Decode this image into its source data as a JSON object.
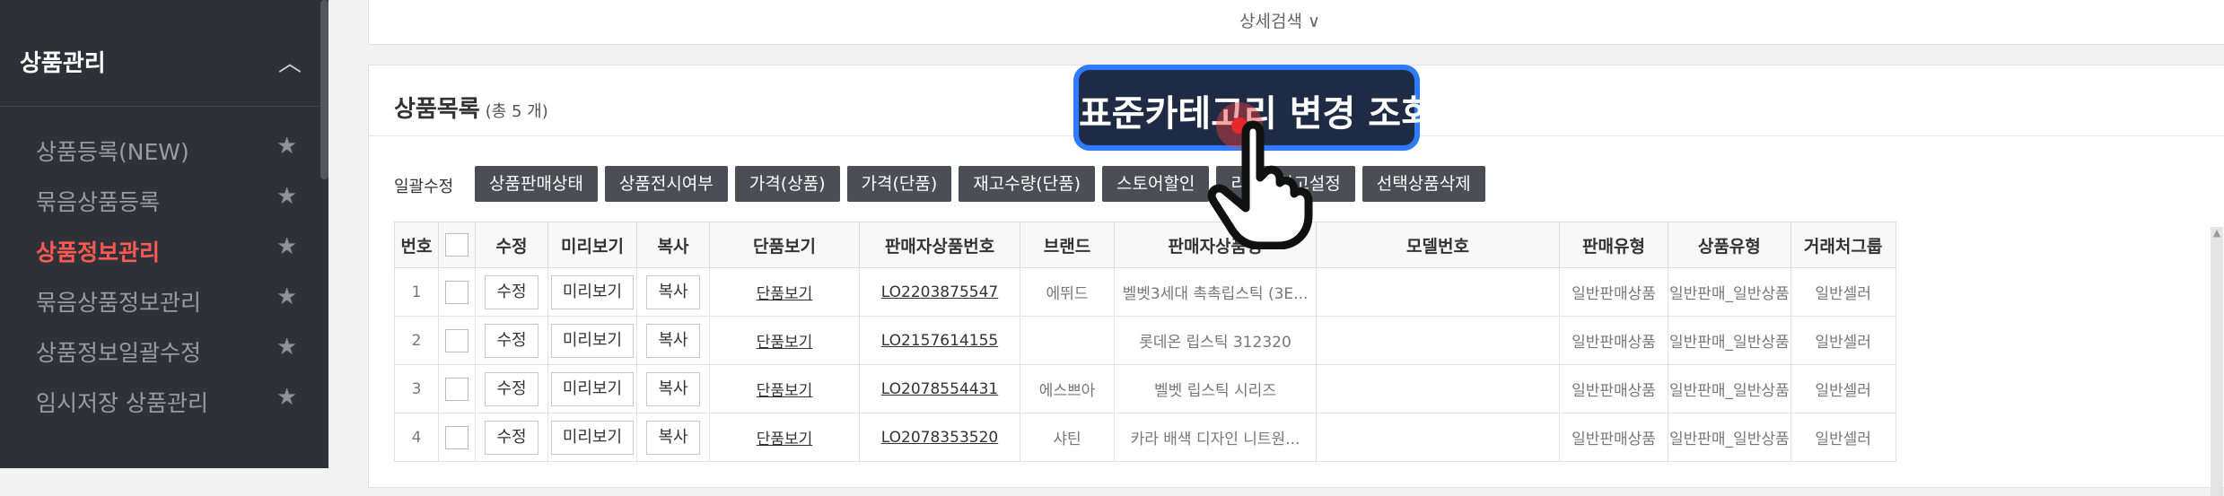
{
  "sidebar": {
    "section_title": "상품관리",
    "items": [
      {
        "label": "상품등록(NEW)",
        "active": false
      },
      {
        "label": "묶음상품등록",
        "active": false
      },
      {
        "label": "상품정보관리",
        "active": true
      },
      {
        "label": "묶음상품정보관리",
        "active": false
      },
      {
        "label": "상품정보일괄수정",
        "active": false
      },
      {
        "label": "임시저장 상품관리",
        "active": false
      }
    ]
  },
  "search": {
    "detail_label": "상세검색 ∨"
  },
  "list": {
    "title": "상품목록",
    "count_text": "(총 5 개)",
    "corner_text": "",
    "bulk_label": "일괄수정",
    "bulk_buttons": [
      "상품판매상태",
      "상품전시여부",
      "가격(상품)",
      "가격(단품)",
      "재고수량(단품)",
      "스토어할인",
      "리스팅광고설정",
      "선택상품삭제"
    ]
  },
  "table": {
    "headers": [
      "번호",
      "",
      "수정",
      "미리보기",
      "복사",
      "단품보기",
      "판매자상품번호",
      "브랜드",
      "판매자상품명",
      "모델번호",
      "판매유형",
      "상품유형",
      "거래처그룹"
    ],
    "action_labels": {
      "edit": "수정",
      "preview": "미리보기",
      "copy": "복사",
      "view": "단품보기"
    },
    "rows": [
      {
        "no": "1",
        "code": "LO2203875547",
        "brand": "에뛰드",
        "name": "벨벳3세대 촉촉립스틱 (3E...",
        "model": "",
        "sale_type": "일반판매상품",
        "prod_type": "일반판매_일반상품",
        "group": "일반셀러"
      },
      {
        "no": "2",
        "code": "LO2157614155",
        "brand": "",
        "name": "롯데온 립스틱 312320",
        "model": "",
        "sale_type": "일반판매상품",
        "prod_type": "일반판매_일반상품",
        "group": "일반셀러"
      },
      {
        "no": "3",
        "code": "LO2078554431",
        "brand": "에스쁘아",
        "name": "벨벳 립스틱 시리즈",
        "model": "",
        "sale_type": "일반판매상품",
        "prod_type": "일반판매_일반상품",
        "group": "일반셀러"
      },
      {
        "no": "4",
        "code": "LO2078353520",
        "brand": "샤틴",
        "name": "카라 배색 디자인 니트원...",
        "model": "",
        "sale_type": "일반판매상품",
        "prod_type": "일반판매_일반상품",
        "group": "일반셀러"
      }
    ]
  },
  "callout": {
    "text": "표준카테고리 변경 조회"
  },
  "colors": {
    "sidebar_bg": "#2f3138",
    "active": "#ff5a52",
    "callout_bg": "#1f2b44",
    "callout_border": "#2f7bff",
    "button_dark": "#4b4e55"
  },
  "icons": {
    "collapse": "chevron-up-icon",
    "favorite": "star-icon",
    "pointer": "hand-pointer-icon"
  }
}
